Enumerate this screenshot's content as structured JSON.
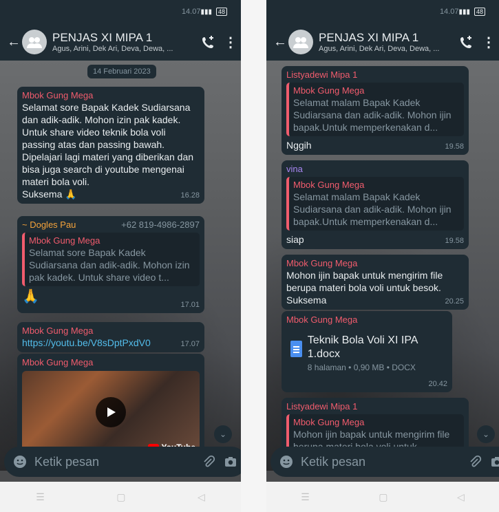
{
  "left": {
    "status": {
      "time": "14.07",
      "battery": "48"
    },
    "header": {
      "title": "PENJAS XI MIPA 1",
      "members": "Agus, Arini, Dek Ari, Deva, Dewa, ..."
    },
    "date_chip": "14 Februari 2023",
    "msg1": {
      "sender": "Mbok Gung Mega",
      "text": "Selamat sore Bapak Kadek Sudiarsana dan adik-adik. Mohon izin pak kadek. Untuk share video teknik bola voli passing atas dan passing bawah. Dipelajari lagi materi yang diberikan dan bisa juga search di youtube mengenai materi bola voli.",
      "text2": "Suksema 🙏",
      "time": "16.28"
    },
    "msg2": {
      "sender": "~ Dogles Pau",
      "phone": "+62 819-4986-2897",
      "quote_sender": "Mbok Gung Mega",
      "quote_text": "Selamat sore Bapak Kadek Sudiarsana dan adik-adik. Mohon izin pak kadek. Untuk share video t...",
      "text": "🙏",
      "time": "17.01"
    },
    "msg3": {
      "sender": "Mbok Gung Mega",
      "link": "https://youtu.be/V8sDptPxdV0",
      "time": "17.07"
    },
    "msg4": {
      "sender": "Mbok Gung Mega",
      "badge": "YouTube"
    },
    "input_placeholder": "Ketik pesan"
  },
  "right": {
    "status": {
      "time": "14.07",
      "battery": "48"
    },
    "header": {
      "title": "PENJAS XI MIPA 1",
      "members": "Agus, Arini, Dek Ari, Deva, Dewa, ..."
    },
    "msg1": {
      "sender": "Listyadewi Mipa 1",
      "quote_sender": "Mbok Gung Mega",
      "quote_text": "Selamat malam Bapak Kadek Sudiarsana dan adik-adik. Mohon ijin bapak.Untuk memperkenakan d...",
      "text": "Nggih",
      "time": "19.58"
    },
    "msg2": {
      "sender": "vina",
      "quote_sender": "Mbok Gung Mega",
      "quote_text": "Selamat malam Bapak Kadek Sudiarsana dan adik-adik. Mohon ijin bapak.Untuk memperkenakan d...",
      "text": "siap",
      "time": "19.58"
    },
    "msg3": {
      "sender": "Mbok Gung Mega",
      "text": "Mohon ijin bapak untuk mengirim file berupa materi bola voli untuk besok. Suksema",
      "time": "20.25"
    },
    "msg4": {
      "sender": "Mbok Gung Mega",
      "doc_name": "Teknik Bola Voli XI IPA 1.docx",
      "doc_meta": "8 halaman • 0,90 MB • DOCX",
      "time": "20.42"
    },
    "msg5": {
      "sender": "Listyadewi Mipa 1",
      "quote_sender": "Mbok Gung Mega",
      "quote_text": "Mohon ijin bapak untuk mengirim file berupa materi bola voli untuk..."
    },
    "input_placeholder": "Ketik pesan"
  }
}
